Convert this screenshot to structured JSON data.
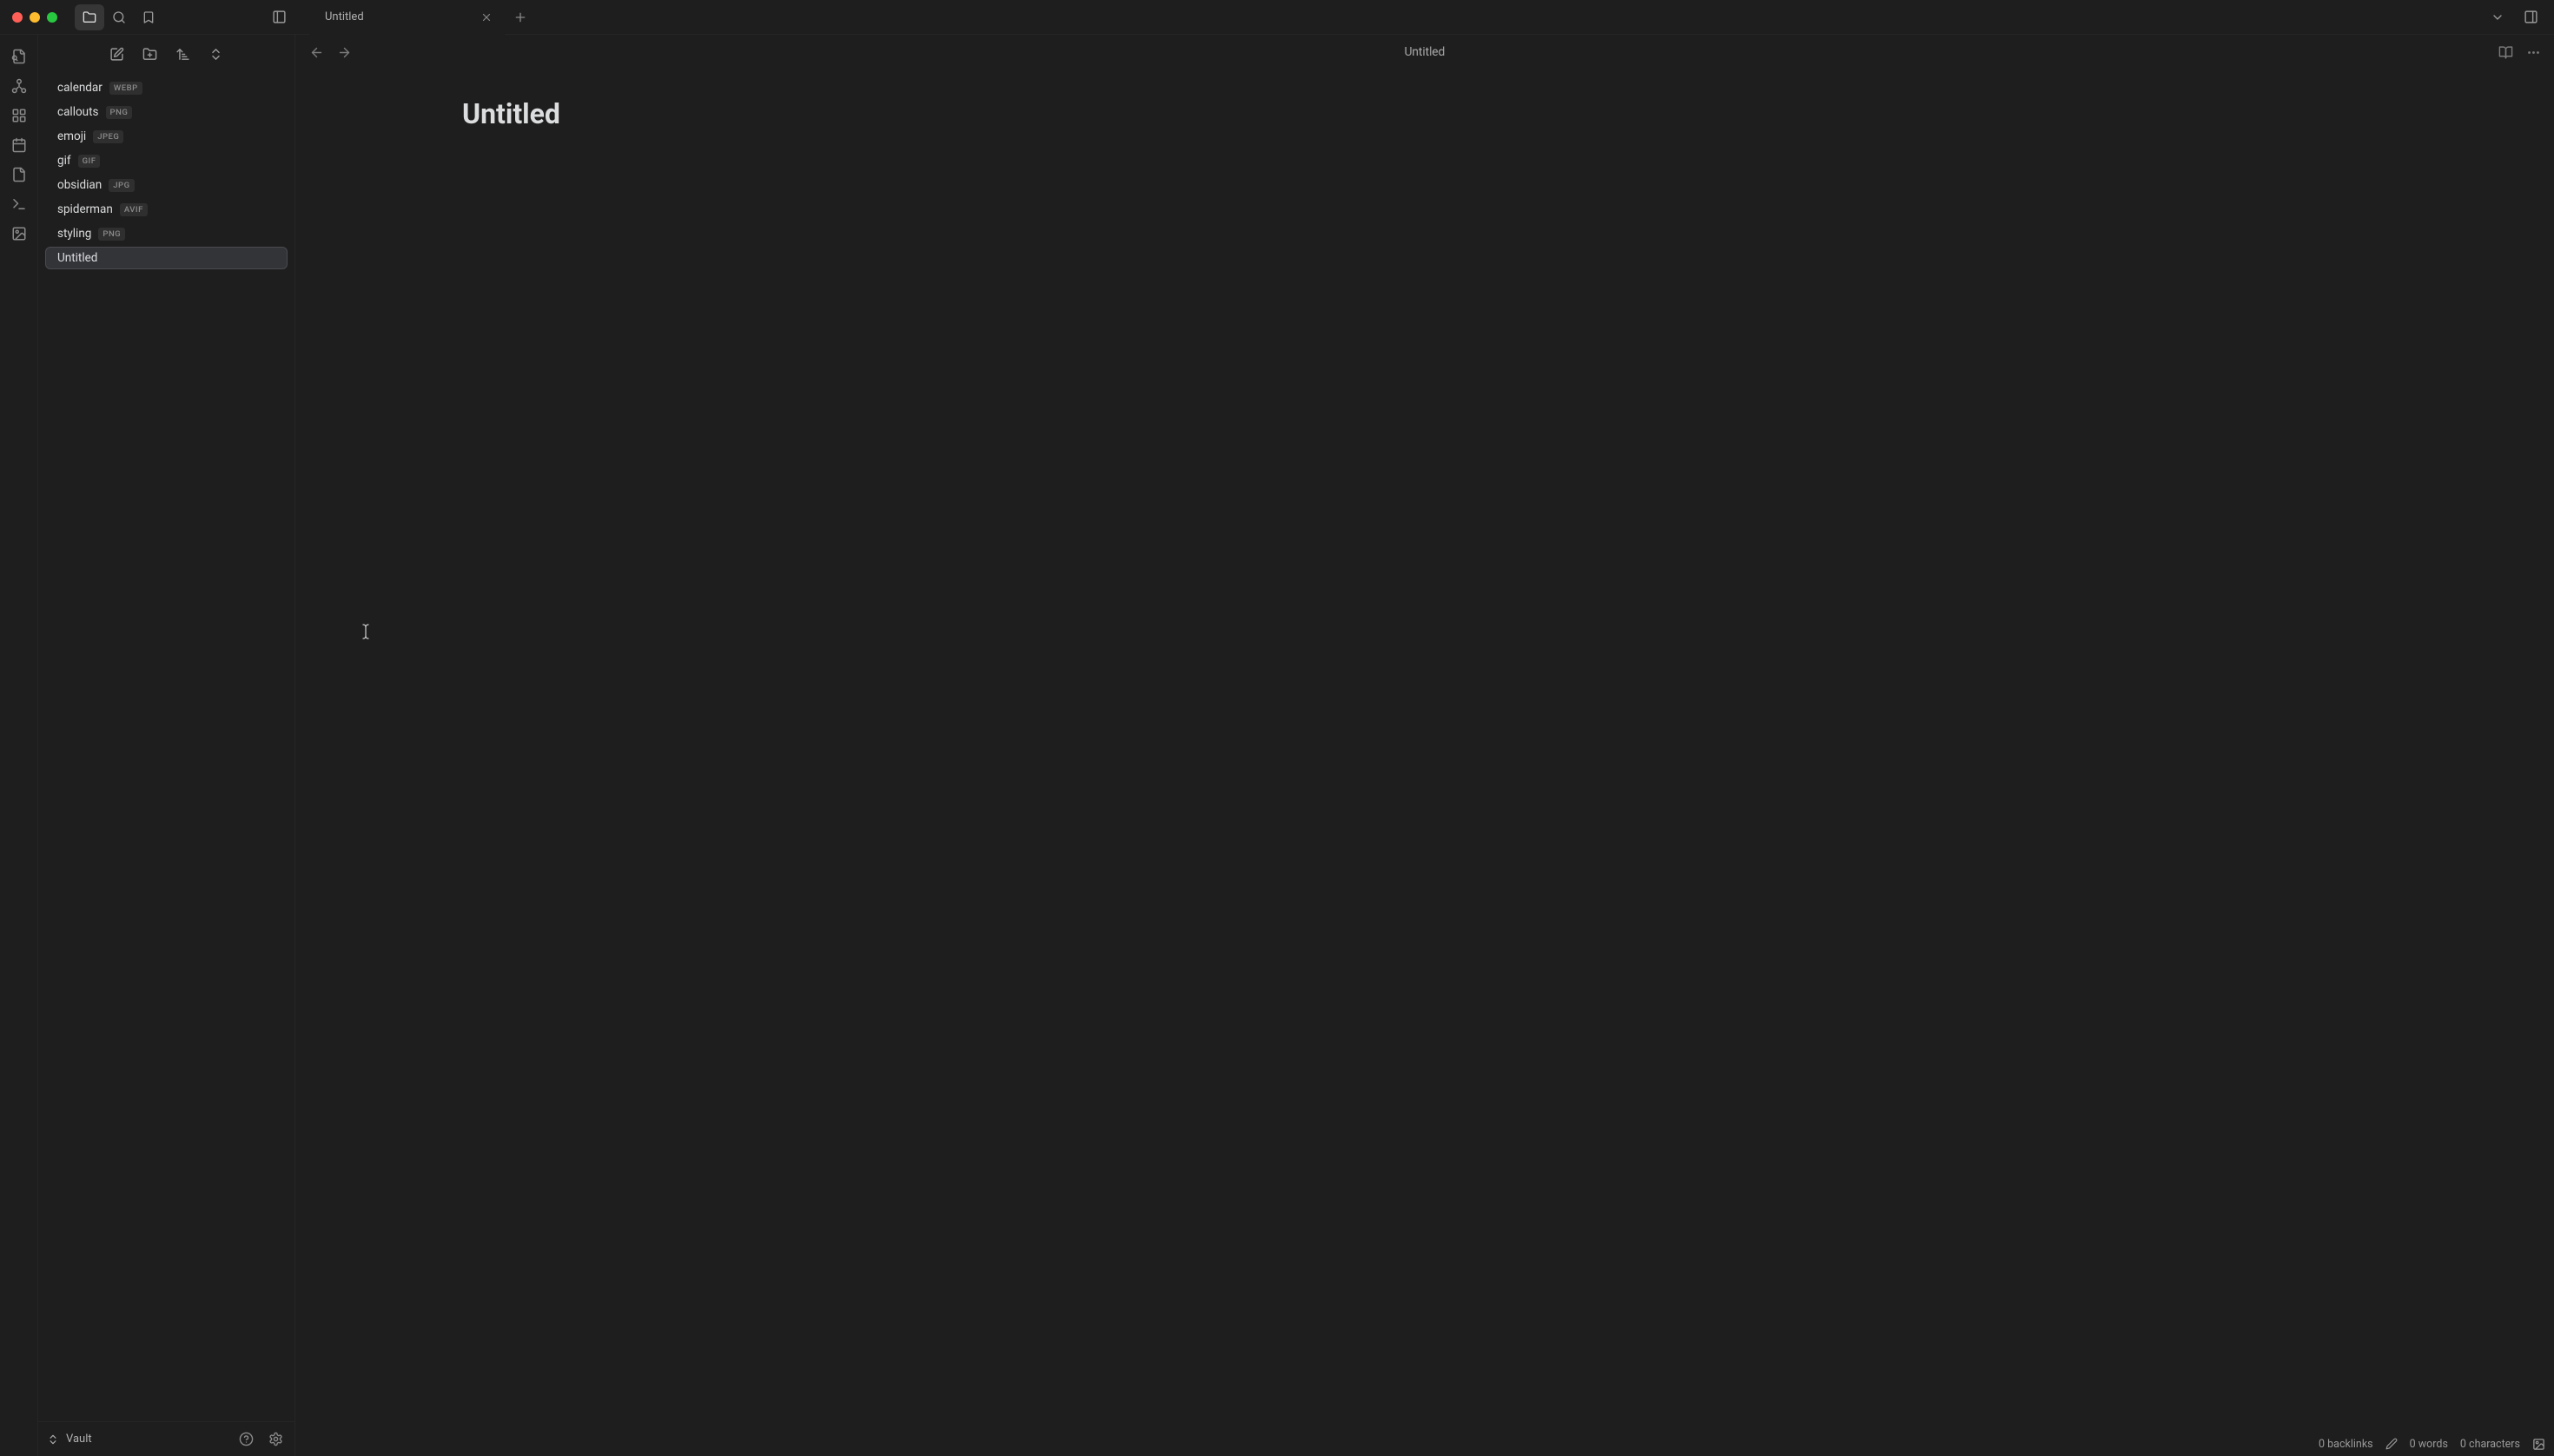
{
  "titlebar": {
    "tab_title": "Untitled"
  },
  "sidebar": {
    "files": [
      {
        "name": "calendar",
        "ext": "WEBP"
      },
      {
        "name": "callouts",
        "ext": "PNG"
      },
      {
        "name": "emoji",
        "ext": "JPEG"
      },
      {
        "name": "gif",
        "ext": "GIF"
      },
      {
        "name": "obsidian",
        "ext": "JPG"
      },
      {
        "name": "spiderman",
        "ext": "AVIF"
      },
      {
        "name": "styling",
        "ext": "PNG"
      },
      {
        "name": "Untitled",
        "ext": ""
      }
    ],
    "vault_name": "Vault"
  },
  "view": {
    "breadcrumb": "Untitled"
  },
  "editor": {
    "title": "Untitled"
  },
  "status": {
    "backlinks": "0 backlinks",
    "words": "0 words",
    "characters": "0 characters"
  }
}
